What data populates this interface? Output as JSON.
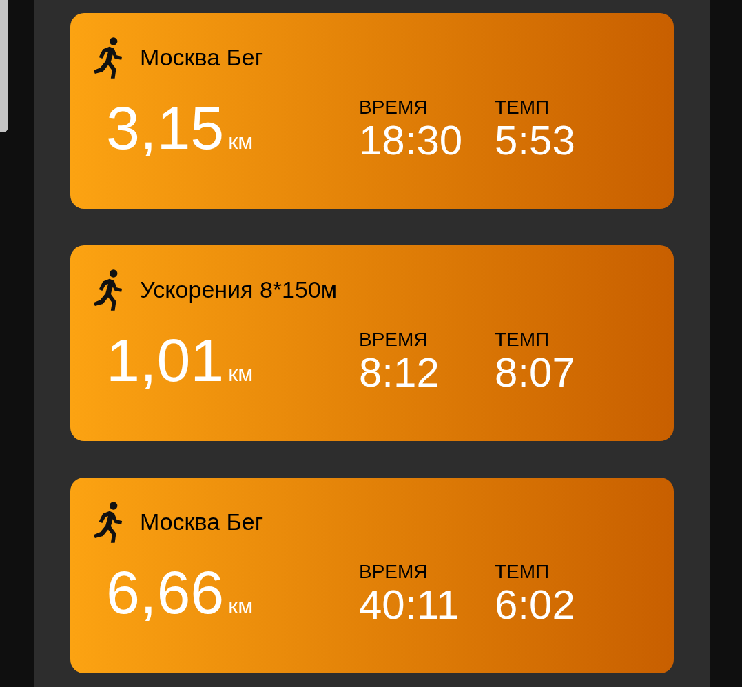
{
  "activities": [
    {
      "title": "Москва Бег",
      "distance": "3,15",
      "unit": "км",
      "stats": [
        {
          "label": "ВРЕМЯ",
          "value": "18:30"
        },
        {
          "label": "ТЕМП",
          "value": "5:53"
        }
      ]
    },
    {
      "title": "Ускорения 8*150м",
      "distance": "1,01",
      "unit": "км",
      "stats": [
        {
          "label": "ВРЕМЯ",
          "value": "8:12"
        },
        {
          "label": "ТЕМП",
          "value": "8:07"
        }
      ]
    },
    {
      "title": "Москва Бег",
      "distance": "6,66",
      "unit": "км",
      "stats": [
        {
          "label": "ВРЕМЯ",
          "value": "40:11"
        },
        {
          "label": "ТЕМП",
          "value": "6:02"
        }
      ]
    }
  ]
}
